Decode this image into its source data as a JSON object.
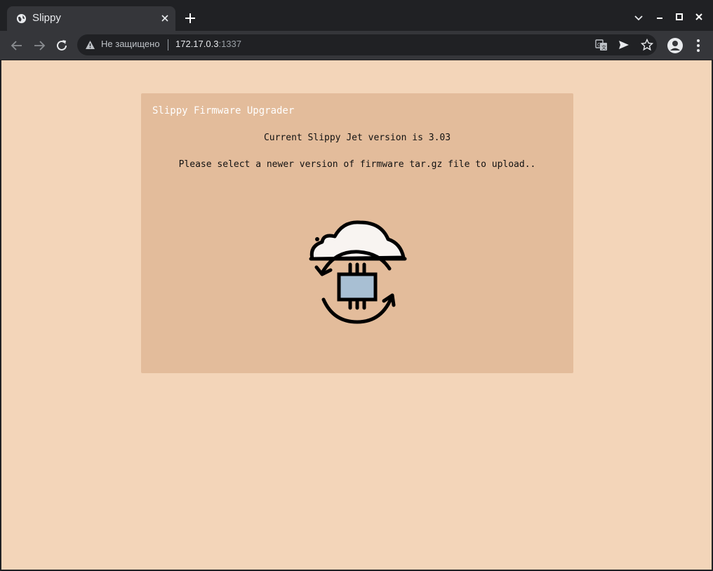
{
  "browser": {
    "tab": {
      "title": "Slippy",
      "favicon": "globe-icon"
    },
    "omnibox": {
      "security_text": "Не защищено",
      "url_host": "172.17.0.3",
      "url_port": ":1337"
    }
  },
  "page": {
    "card_title": "Slippy Firmware Upgrader",
    "version_text": "Current Slippy Jet version is 3.03",
    "instruction_text": "Please select a newer version of firmware tar.gz file to upload..",
    "upload_icon": "cloud-firmware-upload-icon"
  },
  "colors": {
    "page_bg": "#f3d5b9",
    "card_bg": "#e3bc9b",
    "chip_fill": "#a8bfd3",
    "cloud_fill": "#f8f4f1"
  }
}
